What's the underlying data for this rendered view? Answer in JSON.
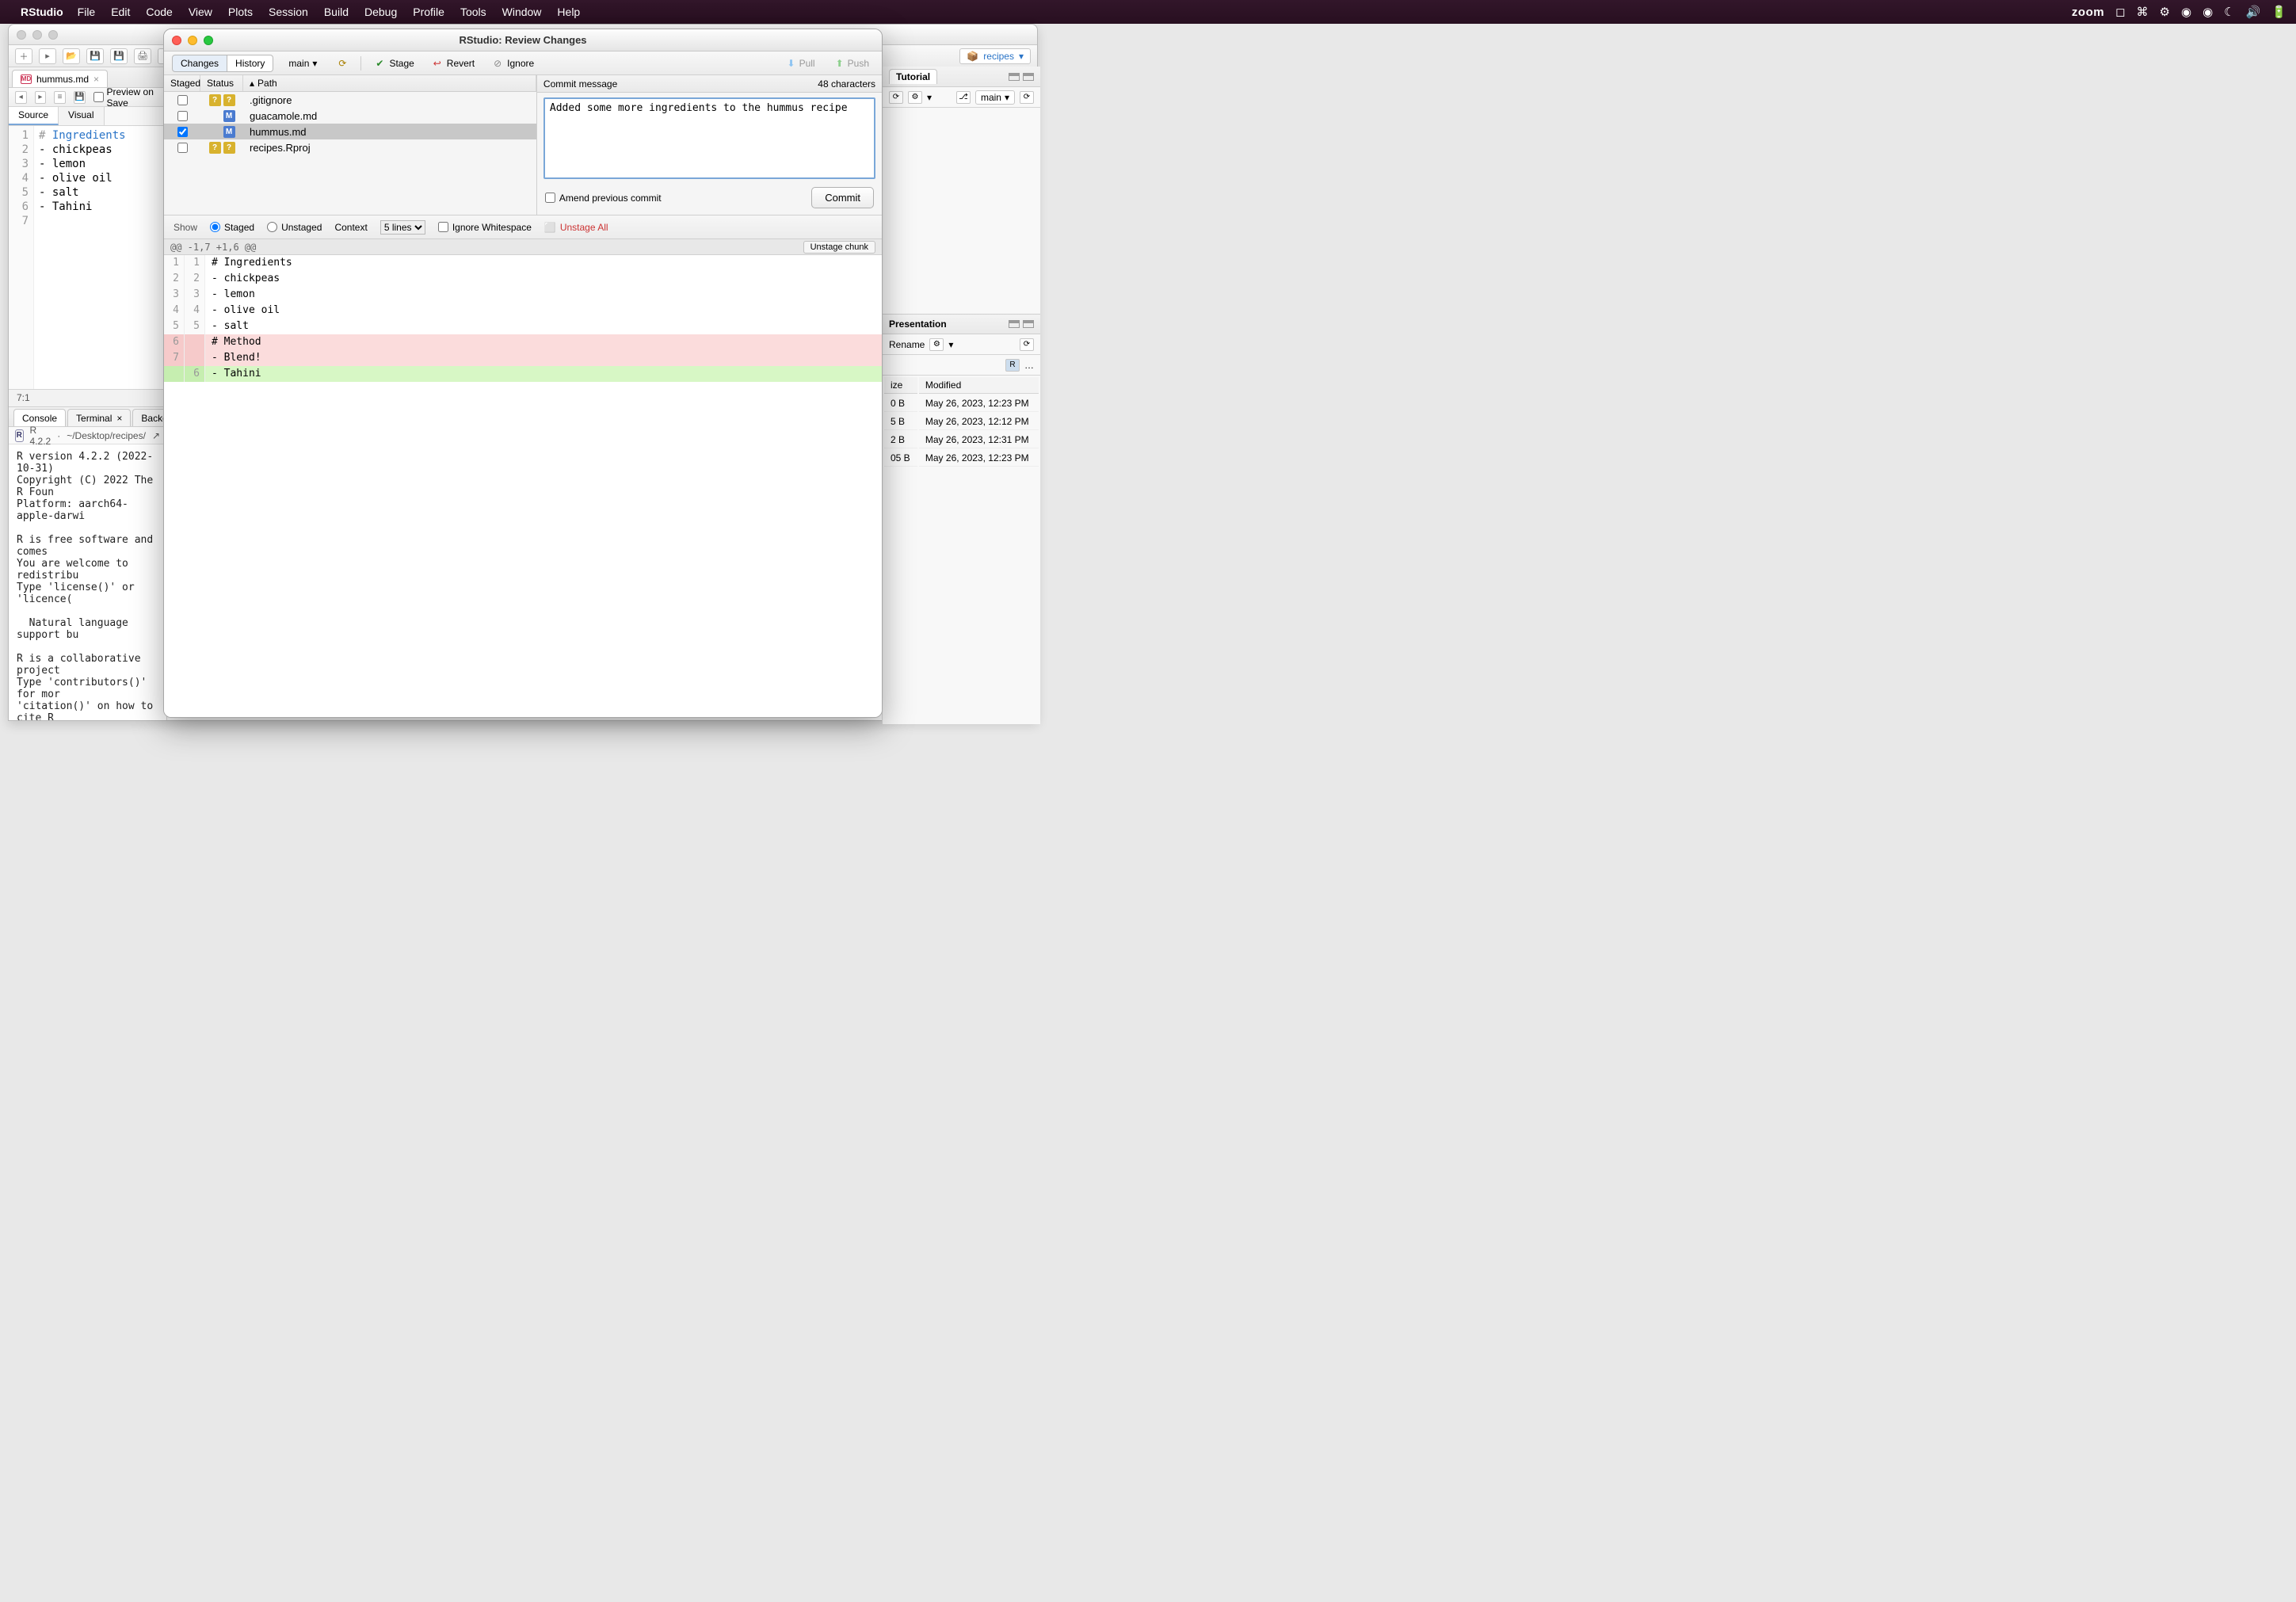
{
  "menubar": {
    "app": "RStudio",
    "items": [
      "File",
      "Edit",
      "Code",
      "View",
      "Plots",
      "Session",
      "Build",
      "Debug",
      "Profile",
      "Tools",
      "Window",
      "Help"
    ],
    "right_text": "zoom"
  },
  "project_selector": "recipes",
  "editor": {
    "tab_filename": "hummus.md",
    "preview_label": "Preview on Save",
    "modes": {
      "source": "Source",
      "visual": "Visual"
    },
    "lines": [
      "# Ingredients",
      "- chickpeas",
      "- lemon",
      "- olive oil",
      "- salt",
      "- Tahini",
      ""
    ],
    "line_numbers": [
      "1",
      "2",
      "3",
      "4",
      "5",
      "6",
      "7"
    ],
    "cursor_status": "7:1"
  },
  "console": {
    "tabs": {
      "console": "Console",
      "terminal": "Terminal",
      "background": "Backgroun"
    },
    "version": "R 4.2.2",
    "path": "~/Desktop/recipes/",
    "output": "R version 4.2.2 (2022-10-31)\nCopyright (C) 2022 The R Foun\nPlatform: aarch64-apple-darwi\n\nR is free software and comes\nYou are welcome to redistribu\nType 'license()' or 'licence(\n\n  Natural language support bu\n\nR is a collaborative project \nType 'contributors()' for mor\n'citation()' on how to cite R\n\nType 'demo()' for some demos,\n'help.start()' for an HTML br\nType 'q()' to quit R.\n"
  },
  "right_panel": {
    "tabs": {
      "tutorial": "Tutorial"
    },
    "branch": "main",
    "presentation_label": "Presentation",
    "rename_label": "Rename",
    "file_columns": {
      "size": "ize",
      "modified": "Modified"
    },
    "files": [
      {
        "size": "0 B",
        "modified": "May 26, 2023, 12:23 PM"
      },
      {
        "size": "5 B",
        "modified": "May 26, 2023, 12:12 PM"
      },
      {
        "size": "2 B",
        "modified": "May 26, 2023, 12:31 PM"
      },
      {
        "size": "05 B",
        "modified": "May 26, 2023, 12:23 PM"
      }
    ]
  },
  "modal": {
    "title": "RStudio: Review Changes",
    "tabs": {
      "changes": "Changes",
      "history": "History"
    },
    "branch": "main",
    "actions": {
      "stage": "Stage",
      "revert": "Revert",
      "ignore": "Ignore",
      "pull": "Pull",
      "push": "Push"
    },
    "file_list": {
      "headers": {
        "staged": "Staged",
        "status": "Status",
        "path": "Path"
      },
      "rows": [
        {
          "staged": false,
          "status": [
            "?",
            "?"
          ],
          "status_class": [
            "sb-q",
            "sb-q"
          ],
          "path": ".gitignore",
          "selected": false
        },
        {
          "staged": false,
          "status": [
            "M"
          ],
          "status_class": [
            "sb-m"
          ],
          "path": "guacamole.md",
          "selected": false
        },
        {
          "staged": true,
          "status": [
            "M"
          ],
          "status_class": [
            "sb-m"
          ],
          "path": "hummus.md",
          "selected": true
        },
        {
          "staged": false,
          "status": [
            "?",
            "?"
          ],
          "status_class": [
            "sb-q",
            "sb-q"
          ],
          "path": "recipes.Rproj",
          "selected": false
        }
      ]
    },
    "commit": {
      "label": "Commit message",
      "char_count": "48 characters",
      "message": "Added some more ingredients to the hummus recipe",
      "amend_label": "Amend previous commit",
      "commit_btn": "Commit"
    },
    "diff_controls": {
      "show": "Show",
      "staged": "Staged",
      "unstaged": "Unstaged",
      "context": "Context",
      "context_value": "5 lines",
      "ignore_ws": "Ignore Whitespace",
      "unstage_all": "Unstage All"
    },
    "diff": {
      "hunk_header": "@@ -1,7 +1,6 @@",
      "unstage_chunk": "Unstage chunk",
      "lines": [
        {
          "old": "1",
          "new": "1",
          "type": "ctx",
          "text": "# Ingredients"
        },
        {
          "old": "2",
          "new": "2",
          "type": "ctx",
          "text": "- chickpeas"
        },
        {
          "old": "3",
          "new": "3",
          "type": "ctx",
          "text": "- lemon"
        },
        {
          "old": "4",
          "new": "4",
          "type": "ctx",
          "text": "- olive oil"
        },
        {
          "old": "5",
          "new": "5",
          "type": "ctx",
          "text": "- salt"
        },
        {
          "old": "6",
          "new": "",
          "type": "removed",
          "text": "# Method"
        },
        {
          "old": "7",
          "new": "",
          "type": "removed",
          "text": "- Blend!"
        },
        {
          "old": "",
          "new": "6",
          "type": "added",
          "text": "- Tahini"
        }
      ]
    }
  }
}
